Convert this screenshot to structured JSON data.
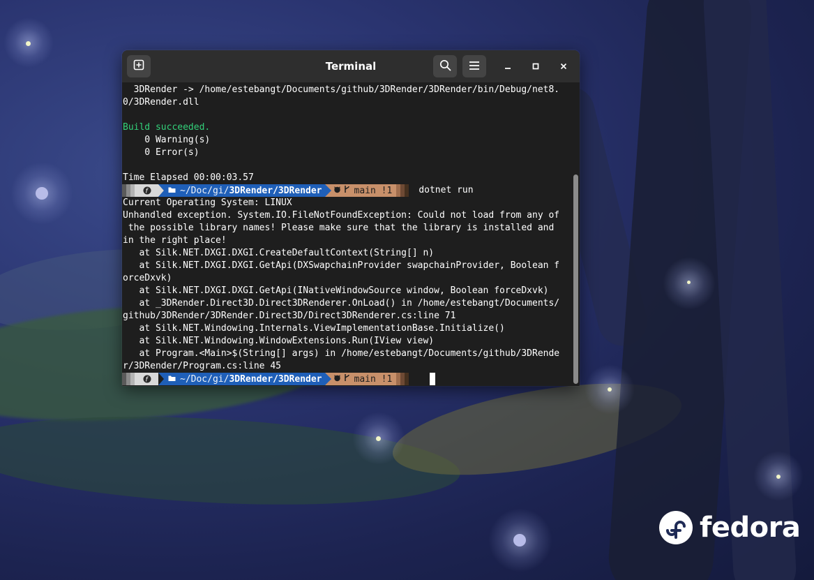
{
  "window": {
    "title": "Terminal",
    "icons": {
      "new_tab": "new-tab-icon",
      "search": "search-icon",
      "menu": "hamburger-menu-icon",
      "minimize": "minimize-icon",
      "maximize": "maximize-icon",
      "close": "close-icon"
    }
  },
  "terminal": {
    "lines": [
      "  3DRender -> /home/estebangt/Documents/github/3DRender/3DRender/bin/Debug/net8.",
      "0/3DRender.dll",
      "",
      "Build succeeded.",
      "    0 Warning(s)",
      "    0 Error(s)",
      "",
      "Time Elapsed 00:00:03.57"
    ],
    "prompt1": {
      "path_prefix": "~/Doc/gi/",
      "path_bold": "3DRender/3DRender",
      "branch": "main !1",
      "command": "dotnet run"
    },
    "output": [
      "Current Operating System: LINUX",
      "Unhandled exception. System.IO.FileNotFoundException: Could not load from any of",
      " the possible library names! Please make sure that the library is installed and",
      "in the right place!",
      "   at Silk.NET.DXGI.DXGI.CreateDefaultContext(String[] n)",
      "   at Silk.NET.DXGI.DXGI.GetApi(DXSwapchainProvider swapchainProvider, Boolean f",
      "orceDxvk)",
      "   at Silk.NET.DXGI.DXGI.GetApi(INativeWindowSource window, Boolean forceDxvk)",
      "   at _3DRender.Direct3D.Direct3DRenderer.OnLoad() in /home/estebangt/Documents/",
      "github/3DRender/3DRender.Direct3D/Direct3DRenderer.cs:line 71",
      "   at Silk.NET.Windowing.Internals.ViewImplementationBase.Initialize()",
      "   at Silk.NET.Windowing.WindowExtensions.Run(IView view)",
      "   at Program.<Main>$(String[] args) in /home/estebangt/Documents/github/3DRende",
      "r/3DRender/Program.cs:line 45"
    ],
    "prompt2": {
      "path_prefix": "~/Doc/gi/",
      "path_bold": "3DRender/3DRender",
      "branch": "main !1",
      "command": ""
    },
    "colors": {
      "background": "#1e1e1e",
      "success": "#33d17a",
      "prompt_os": "#d9d9d9",
      "prompt_path": "#1f5fb8",
      "prompt_git": "#c8906a"
    }
  },
  "desktop": {
    "logo_text": "fedora"
  }
}
